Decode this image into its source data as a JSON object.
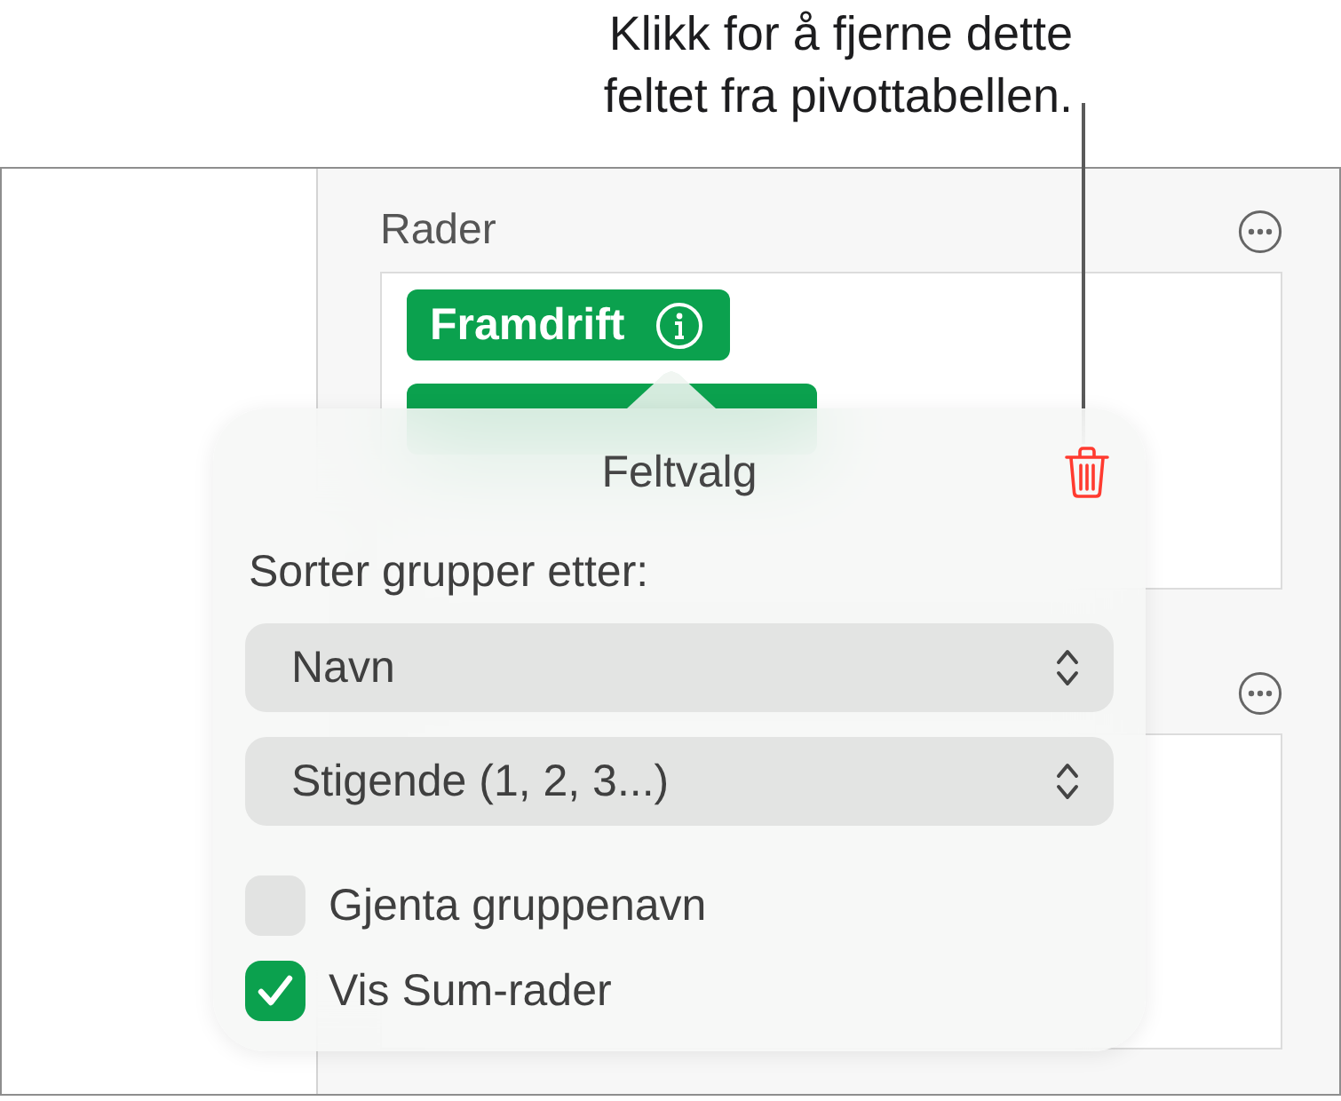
{
  "callout": {
    "lines": [
      "Klikk for å fjerne dette",
      "feltet fra pivottabellen."
    ]
  },
  "panel": {
    "sections": [
      {
        "kind": "titled",
        "title": "Rader",
        "pills": [
          {
            "kind": "labeled",
            "label": "Framdrift"
          },
          {
            "kind": "covered"
          }
        ]
      },
      {
        "kind": "covered"
      }
    ]
  },
  "popover": {
    "title": "Feltvalg",
    "sort_label": "Sorter grupper etter:",
    "selects": [
      {
        "value": "Navn"
      },
      {
        "value": "Stigende (1, 2, 3...)"
      }
    ],
    "options": [
      {
        "label": "Gjenta gruppenavn",
        "checked": false
      },
      {
        "label": "Vis Sum-rader",
        "checked": true
      }
    ]
  }
}
